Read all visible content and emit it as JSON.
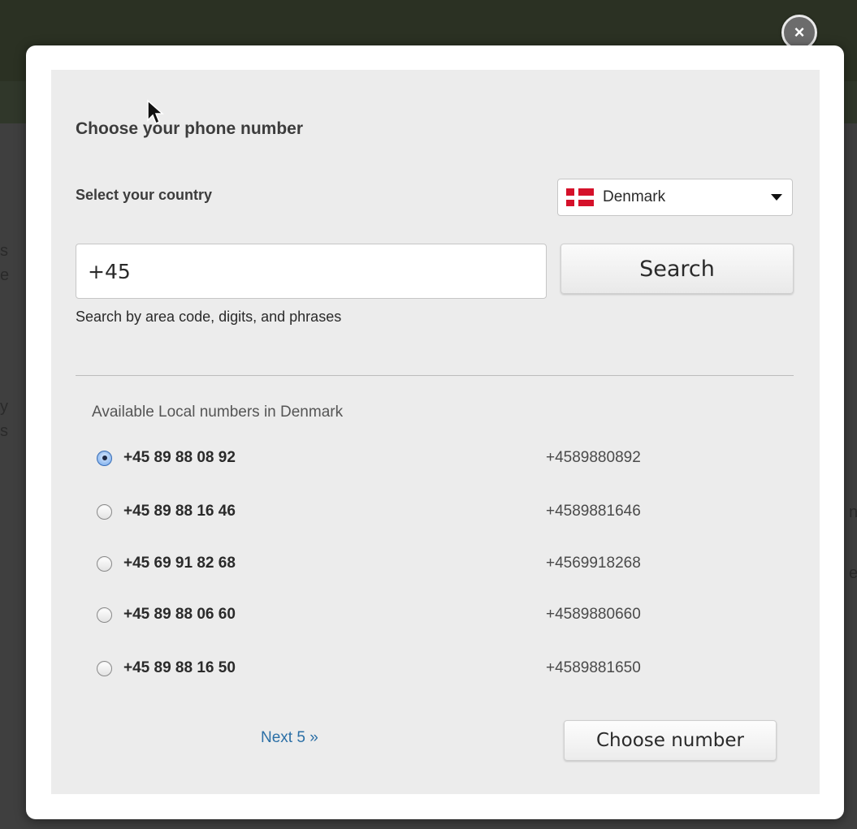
{
  "dialog": {
    "close_label": "×",
    "title": "Choose your phone number",
    "country_label": "Select your country",
    "country": {
      "selected": "Denmark",
      "flag_icon": "denmark-flag-icon"
    },
    "search": {
      "value": "+45",
      "button_label": "Search",
      "helper": "Search by area code, digits, and phrases"
    },
    "results": {
      "heading": "Available Local numbers in Denmark",
      "selected_index": 0,
      "numbers": [
        {
          "formatted": "+45 89 88 08 92",
          "raw": "+4589880892",
          "checked": true
        },
        {
          "formatted": "+45 89 88 16 46",
          "raw": "+4589881646",
          "checked": false
        },
        {
          "formatted": "+45 69 91 82 68",
          "raw": "+4569918268",
          "checked": false
        },
        {
          "formatted": "+45 89 88 06 60",
          "raw": "+4589880660",
          "checked": false
        },
        {
          "formatted": "+45 89 88 16 50",
          "raw": "+4589881650",
          "checked": false
        }
      ]
    },
    "next_label": "Next 5 »",
    "choose_label": "Choose number"
  },
  "colors": {
    "panel_bg": "#ececec",
    "link": "#2b6fa6",
    "flag_red": "#d5112a"
  }
}
